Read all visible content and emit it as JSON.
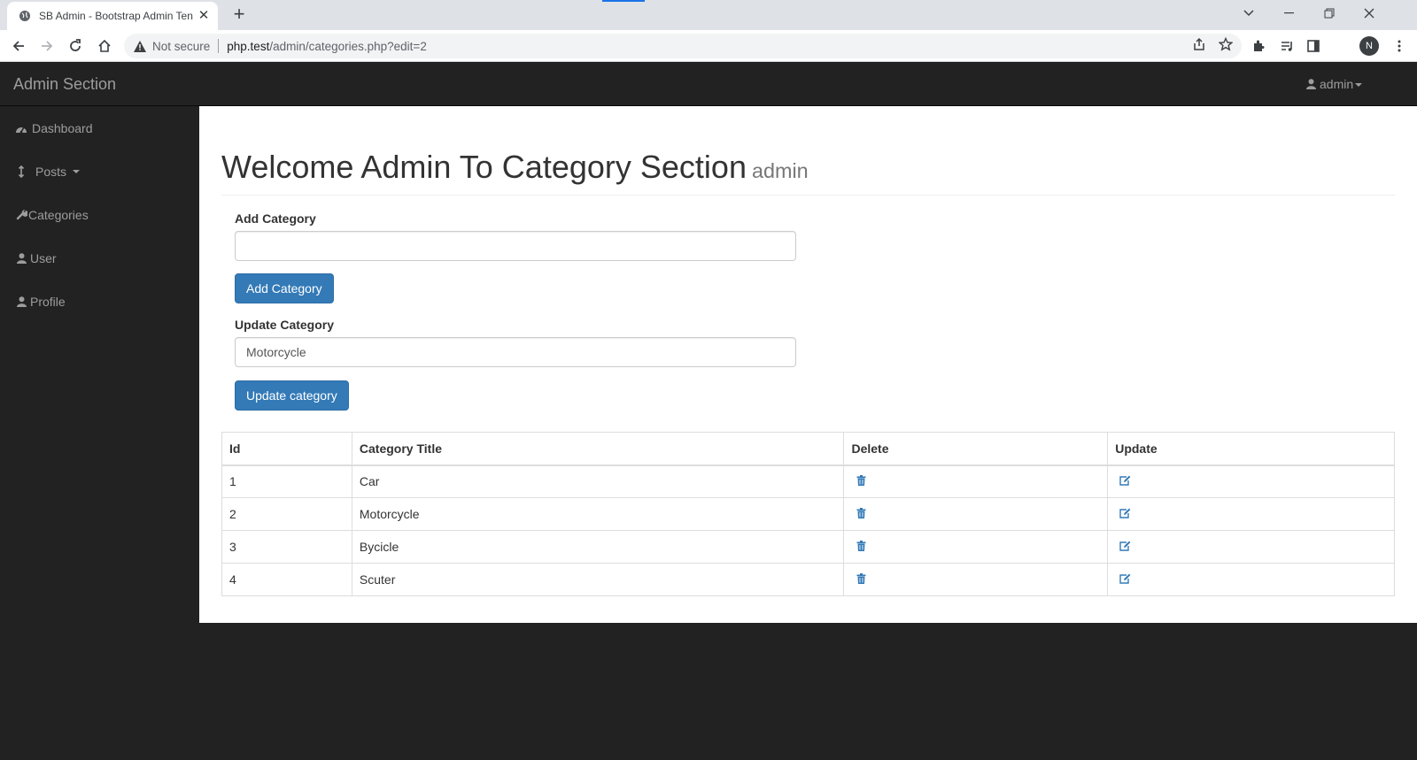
{
  "browser": {
    "tab_title": "SB Admin - Bootstrap Admin Ten",
    "security_label": "Not secure",
    "url_host": "php.test",
    "url_path": "/admin/categories.php?edit=2",
    "profile_initial": "N"
  },
  "navbar": {
    "brand": "Admin Section",
    "user": "admin"
  },
  "sidebar": {
    "items": [
      {
        "label": "Dashboard",
        "icon": "dashboard-icon"
      },
      {
        "label": "Posts",
        "icon": "arrows-vertical-icon"
      },
      {
        "label": "Categories",
        "icon": "wrench-icon"
      },
      {
        "label": "User",
        "icon": "user-icon"
      },
      {
        "label": "Profile",
        "icon": "user-icon"
      }
    ]
  },
  "main": {
    "title": "Welcome Admin To Category Section",
    "subtitle": "admin",
    "add_form": {
      "label": "Add Category",
      "value": "",
      "button": "Add Category"
    },
    "update_form": {
      "label": "Update Category",
      "value": "Motorcycle",
      "button": "Update category"
    },
    "table": {
      "headers": [
        "Id",
        "Category Title",
        "Delete",
        "Update"
      ],
      "rows": [
        {
          "id": "1",
          "title": "Car"
        },
        {
          "id": "2",
          "title": "Motorcycle"
        },
        {
          "id": "3",
          "title": "Bycicle"
        },
        {
          "id": "4",
          "title": "Scuter"
        }
      ]
    }
  },
  "colors": {
    "primary": "#337ab7",
    "navbar_bg": "#222222",
    "nav_text": "#9d9d9d"
  }
}
